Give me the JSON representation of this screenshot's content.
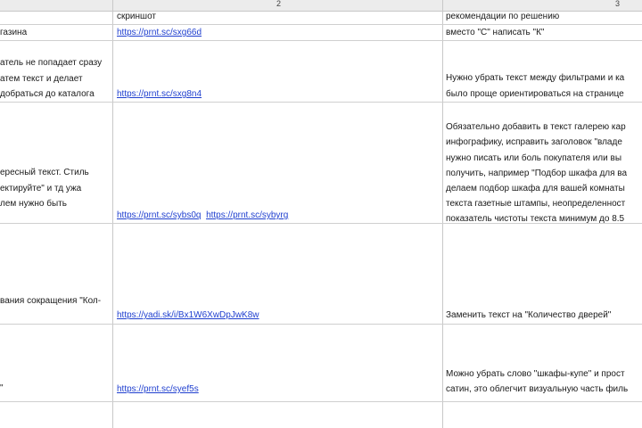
{
  "columns": {
    "col2_number": "2",
    "col3_number": "3"
  },
  "header_row": {
    "col2": "скриншот",
    "col3": "рекомендации по решению"
  },
  "rows": [
    {
      "col1": [
        "газина"
      ],
      "links": [
        "https://prnt.sc/sxg66d"
      ],
      "col3": [
        "вместо \"С\" написать \"К\""
      ]
    },
    {
      "col1": [
        "атель не попадает сразу",
        "атем текст и делает",
        "добраться до каталога"
      ],
      "links": [
        "https://prnt.sc/sxg8n4"
      ],
      "col3": [
        "Нужно убрать текст между фильтрами и ка",
        "было проще ориентироваться на странице"
      ]
    },
    {
      "col1": [
        "ересный текст. Стиль",
        "ектируйте\" и тд ужа",
        "лем нужно быть"
      ],
      "links": [
        "https://prnt.sc/sybs0q",
        "https://prnt.sc/sybyrg"
      ],
      "col3": [
        "Обязательно добавить в текст галерею кар",
        "инфографику, исправить заголовок \"владе",
        "нужно писать или боль покупателя или вы",
        "получить, например \"Подбор шкафа для ва",
        "делаем подбор шкафа для вашей комнаты",
        "текста газетные штампы, неопределенност",
        "показатель чистоты текста минимум до 8.5"
      ]
    },
    {
      "col1": [
        "вания сокращения \"Кол-"
      ],
      "links": [
        "https://yadi.sk/i/Bx1W6XwDpJwK8w"
      ],
      "col3": [
        "Заменить текст на \"Количество дверей\""
      ]
    },
    {
      "col1": [
        "\""
      ],
      "links": [
        "https://prnt.sc/syef5s"
      ],
      "col3": [
        "Можно убрать слово \"шкафы-купе\" и прост",
        "сатин, это облегчит визуальную часть филь"
      ]
    }
  ]
}
